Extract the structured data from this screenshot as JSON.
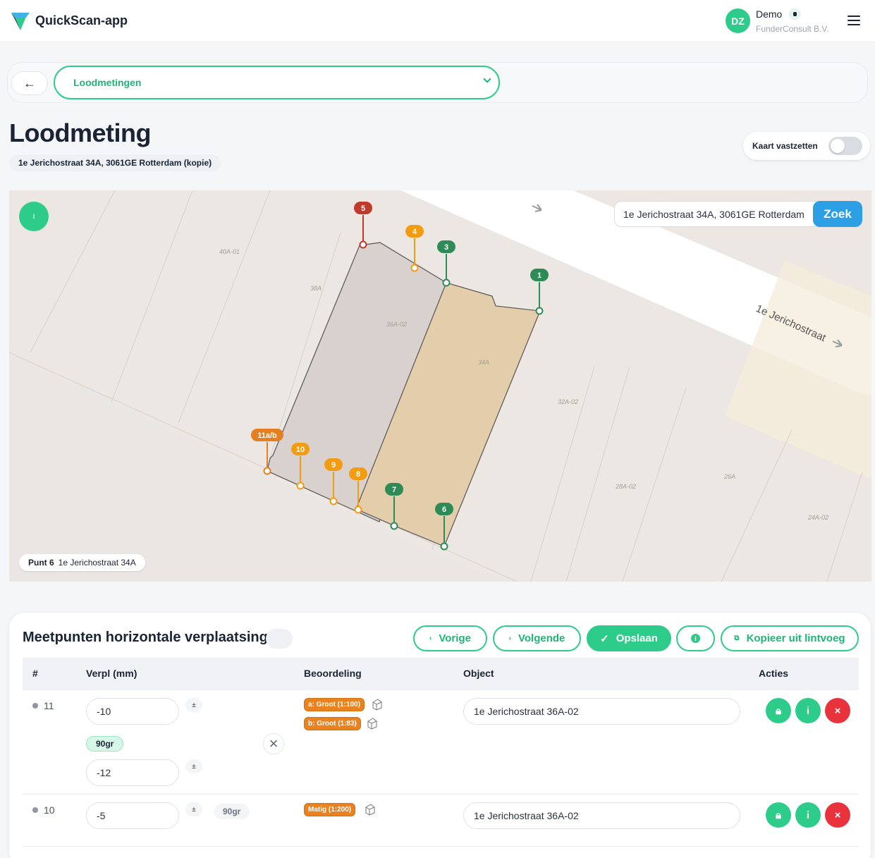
{
  "header": {
    "app_title": "QuickScan-app",
    "avatar_initials": "DZ",
    "user_name": "Demo",
    "user_company": "FunderConsult B.V."
  },
  "nav": {
    "back_label": "←",
    "section_value": "Loodmetingen"
  },
  "page": {
    "title": "Loodmeting",
    "address": "1e Jerichostraat 34A, 3061GE Rotterdam (kopie)",
    "lock_map_label": "Kaart vastzetten",
    "lock_map_on": false
  },
  "map": {
    "search_value": "1e Jerichostraat 34A, 3061GE Rotterdam",
    "search_button": "Zoek",
    "legend_button": "i",
    "street_label": "1e Jerichostraat",
    "parcel_labels": [
      "40A-01",
      "38A",
      "36A-02",
      "34A",
      "32A-02",
      "28A-02",
      "26A",
      "24A-02"
    ],
    "markers": [
      {
        "label": "1",
        "color": "#2e8b57"
      },
      {
        "label": "3",
        "color": "#2e8b57"
      },
      {
        "label": "4",
        "color": "#f39c12"
      },
      {
        "label": "5",
        "color": "#c0392b"
      },
      {
        "label": "6",
        "color": "#2e8b57"
      },
      {
        "label": "7",
        "color": "#2e8b57"
      },
      {
        "label": "8",
        "color": "#f39c12"
      },
      {
        "label": "9",
        "color": "#f39c12"
      },
      {
        "label": "10",
        "color": "#f39c12"
      },
      {
        "label": "11a/b",
        "color": "#e67e22"
      }
    ],
    "selected_point_label": "Punt 6",
    "selected_point_address": "1e Jerichostraat 34A"
  },
  "panel": {
    "title": "Meetpunten horizontale verplaatsing",
    "buttons": {
      "prev": "Vorige",
      "next": "Volgende",
      "save": "Opslaan",
      "info": "i",
      "copy": "Kopieer uit lintvoeg"
    },
    "columns": [
      "#",
      "Verpl (mm)",
      "Beoordeling",
      "Object",
      "Acties"
    ],
    "rows": [
      {
        "num": "11",
        "value_a": "-10",
        "degree": "90gr",
        "value_b": "-12",
        "pm": "±",
        "ratings": [
          "a: Groot (1:100)",
          "b: Groot (1:83)"
        ],
        "object": "1e Jerichostraat 36A-02"
      },
      {
        "num": "10",
        "value_a": "-5",
        "degree": "90gr",
        "pm": "±",
        "ratings": [
          "Matig (1:200)"
        ],
        "object": "1e Jerichostraat 36A-02"
      }
    ]
  },
  "colors": {
    "accent": "#2ecc8a",
    "danger": "#e8333c",
    "warning": "#e9821f",
    "search_blue": "#2c9fe5"
  }
}
